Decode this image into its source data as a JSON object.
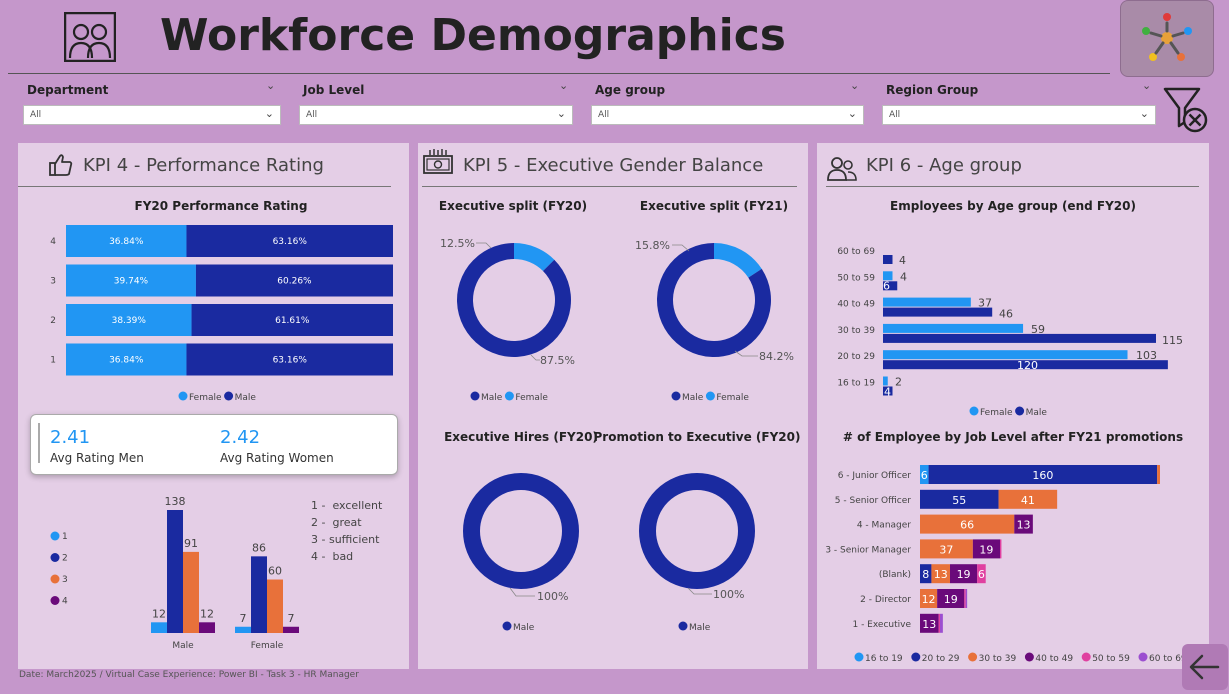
{
  "header": {
    "title": "Workforce Demographics"
  },
  "filters": [
    {
      "label": "Department",
      "value": "All"
    },
    {
      "label": "Job Level",
      "value": "All"
    },
    {
      "label": "Age group",
      "value": "All"
    },
    {
      "label": "Region Group",
      "value": "All"
    }
  ],
  "panels": {
    "kpi4": {
      "title": "KPI 4 - Performance Rating"
    },
    "kpi5": {
      "title": "KPI 5 - Executive Gender Balance"
    },
    "kpi6": {
      "title": "KPI 6 - Age group"
    }
  },
  "card": {
    "men_value": "2.41",
    "men_label": "Avg Rating Men",
    "women_value": "2.42",
    "women_label": "Avg Rating Women"
  },
  "rating_legend": [
    "1 -  excellent",
    "2 -  great",
    "3 - sufficient",
    "4 -  bad"
  ],
  "footer": "Date: March2025 / Virtual Case Experience: Power BI - Task 3 - HR Manager",
  "colors": {
    "female": "#2196f3",
    "male": "#1a2aa0",
    "orange": "#e8713a",
    "purple": "#6a0a7a",
    "pink": "#e040a0",
    "violet": "#9c4fd0",
    "panel": "#e4cee6",
    "background": "#c597cb"
  },
  "chart_data": [
    {
      "id": "perf_rating",
      "type": "bar",
      "orientation": "horizontal-100pct-stacked",
      "title": "FY20 Performance Rating",
      "categories": [
        "4",
        "3",
        "2",
        "1"
      ],
      "series": [
        {
          "name": "Female",
          "values": [
            36.84,
            39.74,
            38.39,
            36.84
          ],
          "labels": [
            "36.84%",
            "39.74%",
            "38.39%",
            "36.84%"
          ]
        },
        {
          "name": "Male",
          "values": [
            63.16,
            60.26,
            61.61,
            63.16
          ],
          "labels": [
            "63.16%",
            "60.26%",
            "61.61%",
            "63.16%"
          ]
        }
      ],
      "legend": "bottom"
    },
    {
      "id": "rating_by_gender",
      "type": "bar",
      "orientation": "vertical-grouped",
      "categories": [
        "Male",
        "Female"
      ],
      "series": [
        {
          "name": "1",
          "values": [
            12,
            7
          ]
        },
        {
          "name": "2",
          "values": [
            138,
            86
          ]
        },
        {
          "name": "3",
          "values": [
            91,
            60
          ]
        },
        {
          "name": "4",
          "values": [
            12,
            7
          ]
        }
      ],
      "legend": "left"
    },
    {
      "id": "exec_split_fy20",
      "type": "pie",
      "donut": true,
      "title": "Executive split (FY20)",
      "slices": [
        {
          "name": "Male",
          "value": 87.5,
          "label": "87.5%"
        },
        {
          "name": "Female",
          "value": 12.5,
          "label": "12.5%"
        }
      ],
      "legend_items": [
        "Male",
        "Female"
      ]
    },
    {
      "id": "exec_split_fy21",
      "type": "pie",
      "donut": true,
      "title": "Executive split (FY21)",
      "slices": [
        {
          "name": "Male",
          "value": 84.2,
          "label": "84.2%"
        },
        {
          "name": "Female",
          "value": 15.8,
          "label": "15.8%"
        }
      ],
      "legend_items": [
        "Male",
        "Female"
      ]
    },
    {
      "id": "exec_hires_fy20",
      "type": "pie",
      "donut": true,
      "title": "Executive Hires (FY20)",
      "slices": [
        {
          "name": "Male",
          "value": 100,
          "label": "100%"
        }
      ],
      "legend_items": [
        "Male"
      ]
    },
    {
      "id": "promo_exec_fy20",
      "type": "pie",
      "donut": true,
      "title": "Promotion to Executive (FY20)",
      "slices": [
        {
          "name": "Male",
          "value": 100,
          "label": "100%"
        }
      ],
      "legend_items": [
        "Male"
      ]
    },
    {
      "id": "age_group",
      "type": "bar",
      "orientation": "horizontal-grouped",
      "title": "Employees by Age group (end FY20)",
      "categories": [
        "60 to 69",
        "50 to 59",
        "40 to 49",
        "30 to 39",
        "20 to 29",
        "16 to 19"
      ],
      "series": [
        {
          "name": "Female",
          "values": [
            0,
            4,
            37,
            59,
            103,
            2
          ]
        },
        {
          "name": "Male",
          "values": [
            4,
            6,
            46,
            115,
            120,
            4
          ]
        }
      ],
      "legend": "bottom"
    },
    {
      "id": "job_level",
      "type": "bar",
      "orientation": "horizontal-stacked",
      "title": "# of Employee by Job Level after FY21 promotions",
      "categories": [
        "6 - Junior Officer",
        "5 - Senior Officer",
        "4 - Manager",
        "3 - Senior Manager",
        "(Blank)",
        "2 - Director",
        "1 - Executive"
      ],
      "series": [
        {
          "name": "16 to 19",
          "values": [
            6,
            0,
            0,
            0,
            0,
            0,
            0
          ]
        },
        {
          "name": "20 to 29",
          "values": [
            160,
            55,
            0,
            0,
            8,
            0,
            0
          ]
        },
        {
          "name": "30 to 39",
          "values": [
            2,
            41,
            66,
            37,
            13,
            12,
            0
          ]
        },
        {
          "name": "40 to 49",
          "values": [
            0,
            0,
            13,
            19,
            19,
            19,
            13
          ]
        },
        {
          "name": "50 to 59",
          "values": [
            0,
            0,
            0,
            1,
            6,
            1,
            1
          ]
        },
        {
          "name": "60 to 69",
          "values": [
            0,
            0,
            0,
            0,
            0,
            1,
            2
          ]
        }
      ],
      "legend": "bottom"
    }
  ]
}
